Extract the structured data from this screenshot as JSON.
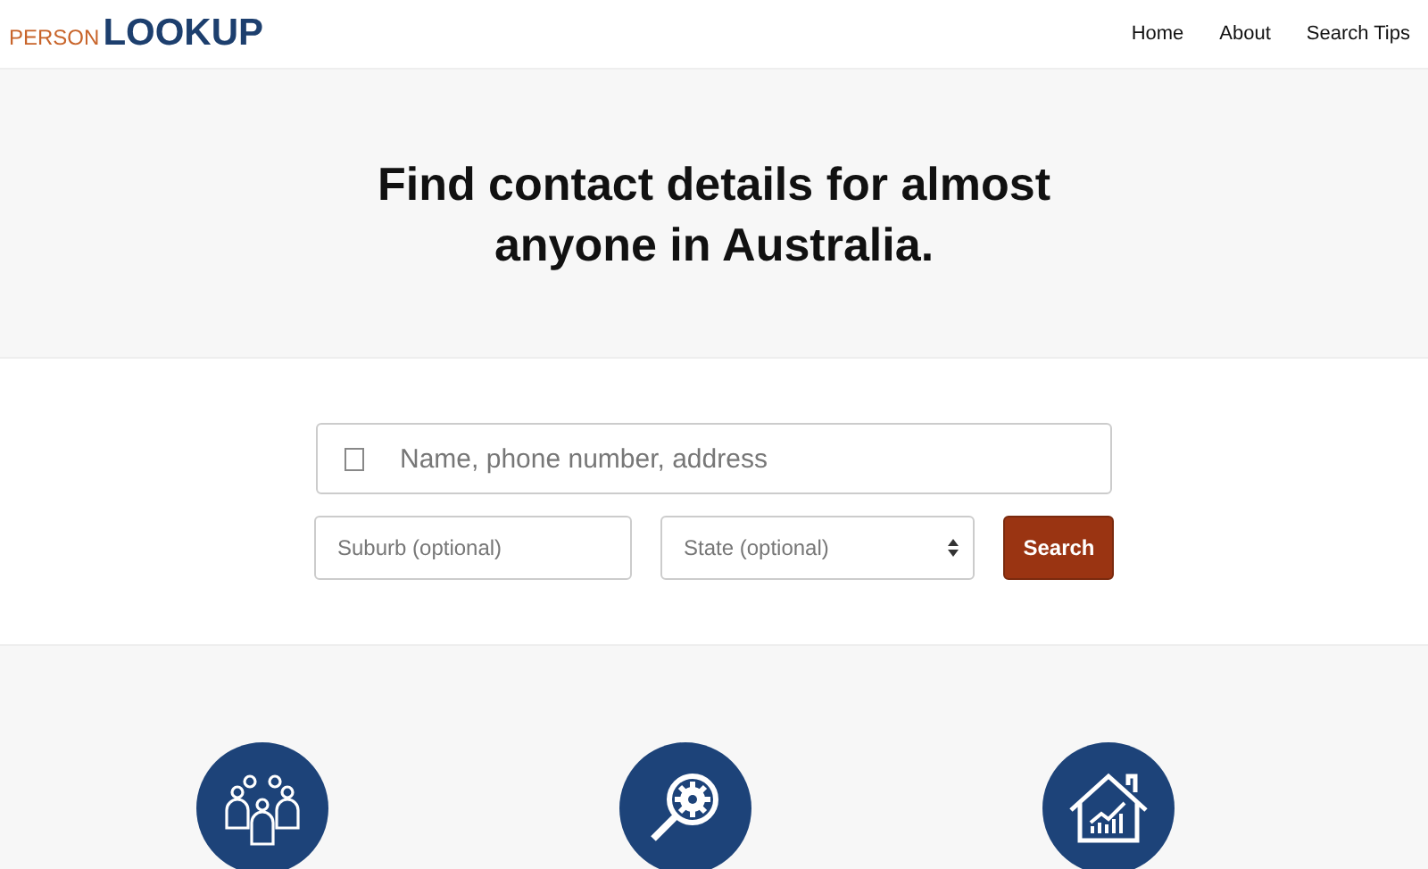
{
  "logo": {
    "prefix": "PERSON",
    "main": "LOOKUP"
  },
  "nav": [
    "Home",
    "About",
    "Search Tips"
  ],
  "hero": {
    "title": "Find contact details for almost anyone in Australia."
  },
  "search": {
    "query": {
      "placeholder": "Name, phone number, address"
    },
    "suburb": {
      "placeholder": "Suburb (optional)"
    },
    "state": {
      "placeholder": "State (optional)"
    },
    "button": "Search"
  },
  "features": [
    {
      "kind": "people"
    },
    {
      "kind": "search"
    },
    {
      "kind": "house"
    }
  ]
}
